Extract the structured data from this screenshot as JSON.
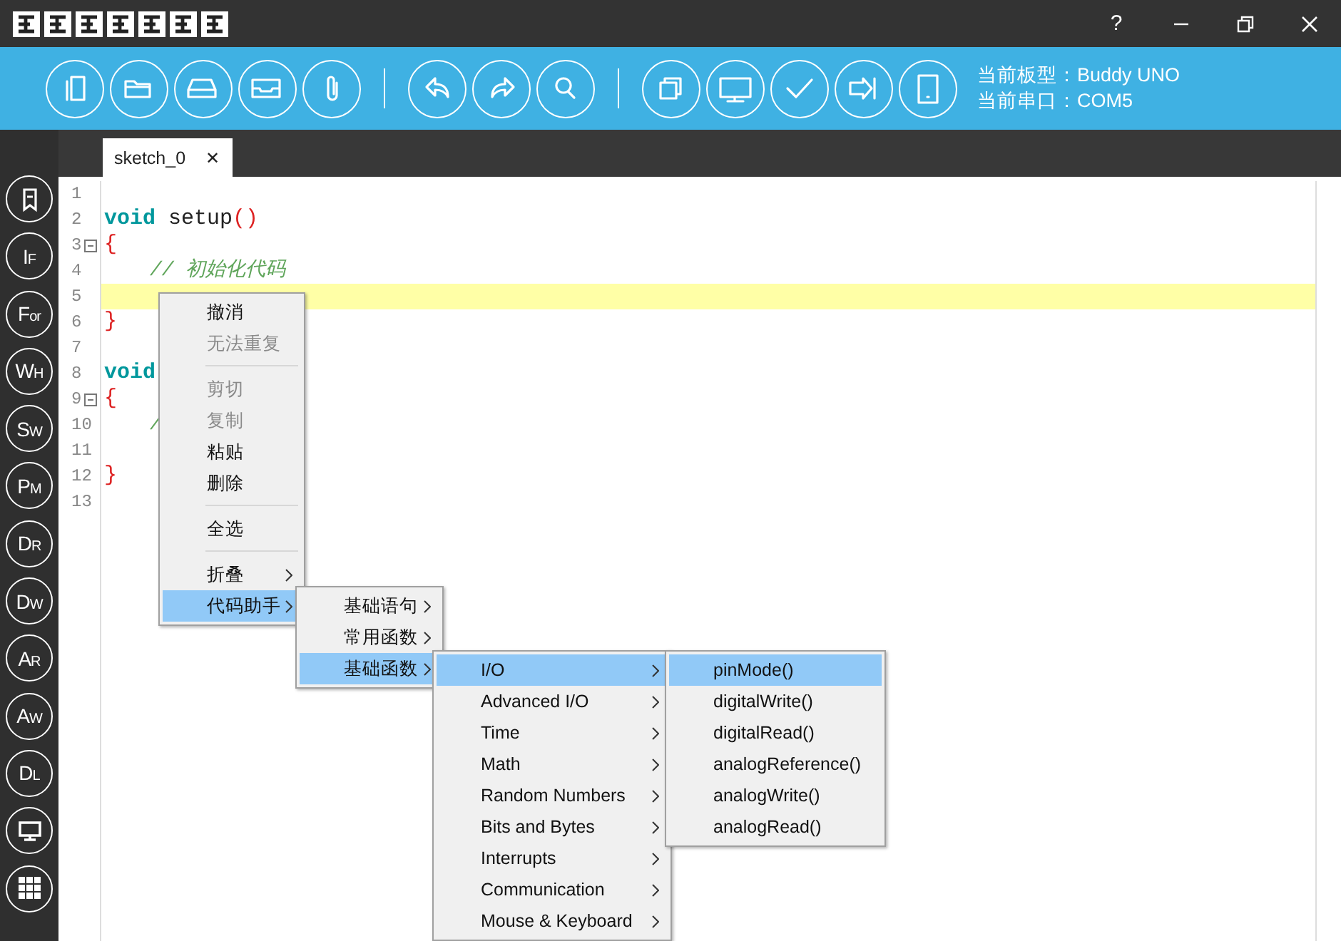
{
  "title_bar": {
    "help": "?"
  },
  "toolbar": {
    "buttons": [
      {
        "kind": "new"
      },
      {
        "kind": "open"
      },
      {
        "kind": "save"
      },
      {
        "kind": "inbox"
      },
      {
        "kind": "attach"
      },
      {
        "kind": "separator"
      },
      {
        "kind": "undo"
      },
      {
        "kind": "redo"
      },
      {
        "kind": "search"
      },
      {
        "kind": "separator"
      },
      {
        "kind": "copy"
      },
      {
        "kind": "monitor"
      },
      {
        "kind": "verify"
      },
      {
        "kind": "upload"
      },
      {
        "kind": "device"
      }
    ],
    "status": [
      "当前板型：Buddy UNO",
      "当前串口：COM5"
    ]
  },
  "sidebar": [
    {
      "kind": "bookmark"
    },
    {
      "kind": "text",
      "label": "IF"
    },
    {
      "kind": "text",
      "label": "For"
    },
    {
      "kind": "text",
      "label": "WH"
    },
    {
      "kind": "text",
      "label": "SW"
    },
    {
      "kind": "text",
      "label": "PM"
    },
    {
      "kind": "text",
      "label": "DR"
    },
    {
      "kind": "text",
      "label": "DW"
    },
    {
      "kind": "text",
      "label": "AR"
    },
    {
      "kind": "text",
      "label": "AW"
    },
    {
      "kind": "text",
      "label": "DL"
    },
    {
      "kind": "monitor"
    },
    {
      "kind": "grid"
    }
  ],
  "tabs": [
    {
      "label": "sketch_0",
      "selected": true,
      "close": "✕"
    }
  ],
  "editor": {
    "lines": [
      {
        "number": "1",
        "fold": false,
        "current": false
      },
      {
        "number": "2",
        "fold": false,
        "current": false,
        "tokens": [
          {
            "kind": "keyword",
            "text": "void"
          },
          {
            "kind": "plain",
            "text": " setup"
          },
          {
            "kind": "paren",
            "text": "()"
          }
        ]
      },
      {
        "number": "3",
        "fold": true,
        "current": false,
        "tokens": [
          {
            "kind": "paren",
            "text": "{"
          }
        ]
      },
      {
        "number": "4",
        "fold": false,
        "current": false,
        "kind": "indented",
        "tokens": [
          {
            "kind": "comment",
            "text": "// 初始化代码"
          }
        ]
      },
      {
        "number": "5",
        "fold": false,
        "current": true
      },
      {
        "number": "6",
        "fold": false,
        "current": false,
        "tokens": [
          {
            "kind": "paren",
            "text": "}"
          }
        ]
      },
      {
        "number": "7",
        "fold": false,
        "current": false
      },
      {
        "number": "8",
        "fold": false,
        "current": false,
        "tokens": [
          {
            "kind": "keyword",
            "text": "void"
          }
        ]
      },
      {
        "number": "9",
        "fold": true,
        "current": false,
        "tokens": [
          {
            "kind": "paren",
            "text": "{"
          }
        ]
      },
      {
        "number": "10",
        "fold": false,
        "current": false,
        "kind": "indented",
        "tokens": [
          {
            "kind": "comment",
            "text": "/"
          }
        ]
      },
      {
        "number": "11",
        "fold": false,
        "current": false
      },
      {
        "number": "12",
        "fold": false,
        "current": false,
        "tokens": [
          {
            "kind": "paren",
            "text": "}"
          }
        ]
      },
      {
        "number": "13",
        "fold": false,
        "current": false
      }
    ]
  },
  "menus": [
    {
      "items": [
        {
          "kind": "item",
          "label": "撤消",
          "disabled": false,
          "selected": false,
          "submenu": false
        },
        {
          "kind": "item",
          "label": "无法重复",
          "disabled": true,
          "selected": false,
          "submenu": false
        },
        {
          "kind": "separator"
        },
        {
          "kind": "item",
          "label": "剪切",
          "disabled": true,
          "selected": false,
          "submenu": false
        },
        {
          "kind": "item",
          "label": "复制",
          "disabled": true,
          "selected": false,
          "submenu": false
        },
        {
          "kind": "item",
          "label": "粘贴",
          "disabled": false,
          "selected": false,
          "submenu": false
        },
        {
          "kind": "item",
          "label": "删除",
          "disabled": false,
          "selected": false,
          "submenu": false
        },
        {
          "kind": "separator"
        },
        {
          "kind": "item",
          "label": "全选",
          "disabled": false,
          "selected": false,
          "submenu": false
        },
        {
          "kind": "separator"
        },
        {
          "kind": "item",
          "label": "折叠",
          "disabled": false,
          "selected": false,
          "submenu": true
        },
        {
          "kind": "item",
          "label": "代码助手",
          "disabled": false,
          "selected": true,
          "submenu": true
        }
      ]
    },
    {
      "items": [
        {
          "kind": "item",
          "label": "基础语句",
          "disabled": false,
          "selected": false,
          "submenu": true
        },
        {
          "kind": "item",
          "label": "常用函数",
          "disabled": false,
          "selected": false,
          "submenu": true
        },
        {
          "kind": "item",
          "label": "基础函数",
          "disabled": false,
          "selected": true,
          "submenu": true
        }
      ]
    },
    {
      "items": [
        {
          "kind": "item",
          "label": "I/O",
          "disabled": false,
          "selected": true,
          "submenu": true
        },
        {
          "kind": "item",
          "label": "Advanced I/O",
          "disabled": false,
          "selected": false,
          "submenu": true
        },
        {
          "kind": "item",
          "label": "Time",
          "disabled": false,
          "selected": false,
          "submenu": true
        },
        {
          "kind": "item",
          "label": "Math",
          "disabled": false,
          "selected": false,
          "submenu": true
        },
        {
          "kind": "item",
          "label": "Random Numbers",
          "disabled": false,
          "selected": false,
          "submenu": true
        },
        {
          "kind": "item",
          "label": "Bits and Bytes",
          "disabled": false,
          "selected": false,
          "submenu": true
        },
        {
          "kind": "item",
          "label": "Interrupts",
          "disabled": false,
          "selected": false,
          "submenu": true
        },
        {
          "kind": "item",
          "label": "Communication",
          "disabled": false,
          "selected": false,
          "submenu": true
        },
        {
          "kind": "item",
          "label": "Mouse & Keyboard",
          "disabled": false,
          "selected": false,
          "submenu": true
        }
      ]
    },
    {
      "items": [
        {
          "kind": "item",
          "label": "pinMode()",
          "disabled": false,
          "selected": true,
          "submenu": false
        },
        {
          "kind": "item",
          "label": "digitalWrite()",
          "disabled": false,
          "selected": false,
          "submenu": false
        },
        {
          "kind": "item",
          "label": "digitalRead()",
          "disabled": false,
          "selected": false,
          "submenu": false
        },
        {
          "kind": "item",
          "label": "analogReference()",
          "disabled": false,
          "selected": false,
          "submenu": false
        },
        {
          "kind": "item",
          "label": "analogWrite()",
          "disabled": false,
          "selected": false,
          "submenu": false
        },
        {
          "kind": "item",
          "label": "analogRead()",
          "disabled": false,
          "selected": false,
          "submenu": false
        }
      ]
    }
  ]
}
